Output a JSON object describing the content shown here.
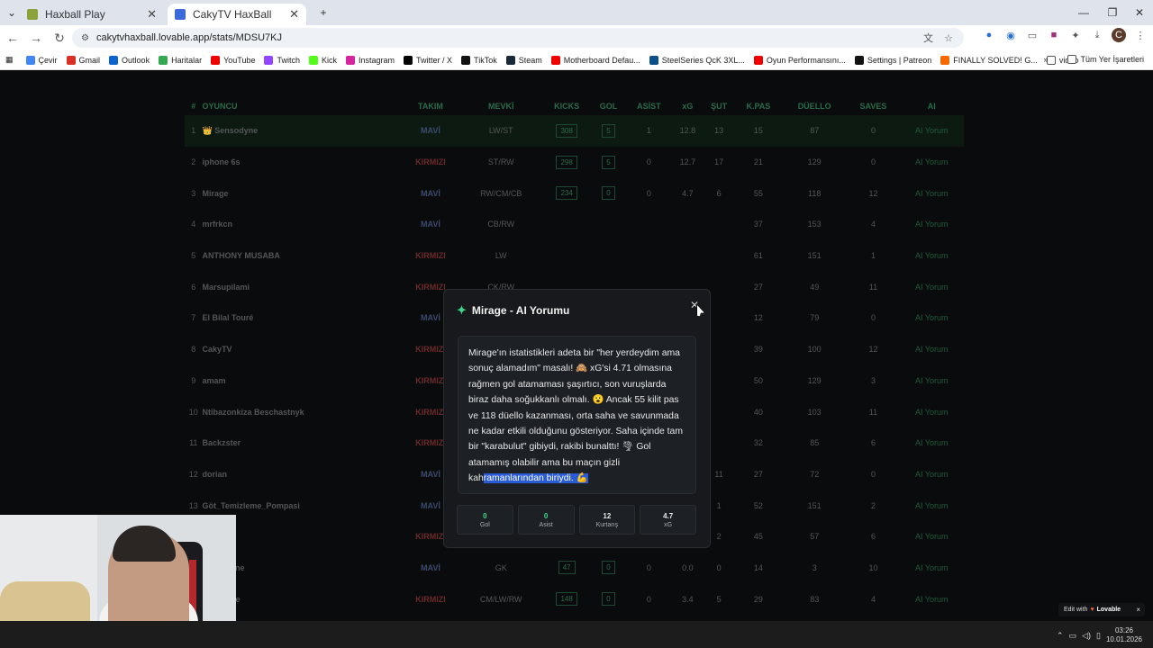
{
  "browser": {
    "tabs": [
      {
        "label": "Haxball Play",
        "favicon_color": "#8aa13c",
        "active": false
      },
      {
        "label": "CakyTV HaxBall",
        "favicon_color": "#3b6bd6",
        "active": true
      }
    ],
    "new_tab_icon": "plus-icon",
    "url": "cakytvhaxball.lovable.app/stats/MDSU7KJ",
    "bookmarks": [
      "Çevir",
      "Gmail",
      "Outlook",
      "Haritalar",
      "YouTube",
      "Twitch",
      "Kick",
      "Instagram",
      "Twitter / X",
      "TikTok",
      "Steam",
      "Motherboard Defau...",
      "SteelSeries QcK 3XL...",
      "Oyun Performansını...",
      "Settings | Patreon",
      "FINALLY SOLVED! G...",
      "video"
    ],
    "bookmarks_more": "»",
    "all_bookmarks": "Tüm Yer İşaretleri"
  },
  "table": {
    "headers": [
      "#",
      "OYUNCU",
      "TAKIM",
      "MEVKİ",
      "KICKS",
      "GOL",
      "ASİST",
      "xG",
      "ŞUT",
      "K.PAS",
      "DÜELLO",
      "SAVES",
      "AI"
    ],
    "rows": [
      [
        "1",
        "👑 Sensodyne",
        "MAVİ",
        "LW/ST",
        "308",
        "5",
        "1",
        "12.8",
        "13",
        "15",
        "87",
        "0",
        "AI Yorum"
      ],
      [
        "2",
        "iphone 6s",
        "KIRMIZI",
        "ST/RW",
        "298",
        "5",
        "0",
        "12.7",
        "17",
        "21",
        "129",
        "0",
        "AI Yorum"
      ],
      [
        "3",
        "Mirage",
        "MAVİ",
        "RW/CM/CB",
        "234",
        "0",
        "0",
        "4.7",
        "6",
        "55",
        "118",
        "12",
        "AI Yorum"
      ],
      [
        "4",
        "mrfrkcn",
        "MAVİ",
        "CB/RW",
        "",
        "",
        "",
        "",
        "",
        "37",
        "153",
        "4",
        "AI Yorum"
      ],
      [
        "5",
        "ANTHONY MUSABA",
        "KIRMIZI",
        "LW",
        "",
        "",
        "",
        "",
        "",
        "61",
        "151",
        "1",
        "AI Yorum"
      ],
      [
        "6",
        "Marsupilami",
        "KIRMIZI",
        "CK/RW",
        "",
        "",
        "",
        "",
        "",
        "27",
        "49",
        "11",
        "AI Yorum"
      ],
      [
        "7",
        "El Bilal Touré",
        "MAVİ",
        "",
        "",
        "",
        "",
        "",
        "",
        "12",
        "79",
        "0",
        "AI Yorum"
      ],
      [
        "8",
        "CakyTV",
        "KIRMIZI",
        "",
        "",
        "",
        "",
        "",
        "",
        "39",
        "100",
        "12",
        "AI Yorum"
      ],
      [
        "9",
        "amam",
        "KIRMIZI",
        "RW/ST",
        "",
        "",
        "",
        "",
        "",
        "50",
        "129",
        "3",
        "AI Yorum"
      ],
      [
        "10",
        "Ntibazonkiza Beschastnyk",
        "KIRMIZI",
        "",
        "",
        "",
        "",
        "",
        "",
        "40",
        "103",
        "11",
        "AI Yorum"
      ],
      [
        "11",
        "Backzster",
        "KIRMIZI",
        "CB/RW",
        "",
        "",
        "",
        "",
        "",
        "32",
        "85",
        "6",
        "AI Yorum"
      ],
      [
        "12",
        "dorian",
        "MAVİ",
        "LW/RW/ST",
        "159",
        "1",
        "1",
        "7.7",
        "11",
        "27",
        "72",
        "0",
        "AI Yorum"
      ],
      [
        "13",
        "Göt_Temizleme_Pompasi",
        "MAVİ",
        "ST/LW/CB",
        "287",
        "0",
        "1",
        "2.4",
        "1",
        "52",
        "151",
        "2",
        "AI Yorum"
      ],
      [
        "14",
        "arez",
        "KIRMIZI",
        "GK/CK",
        "156",
        "0",
        "0",
        "0.3",
        "2",
        "45",
        "57",
        "6",
        "AI Yorum"
      ],
      [
        "15",
        "warepyone",
        "MAVİ",
        "GK",
        "47",
        "0",
        "0",
        "0.0",
        "0",
        "14",
        "3",
        "10",
        "AI Yorum"
      ],
      [
        "16",
        "eslingerie",
        "KIRMIZI",
        "CM/LW/RW",
        "148",
        "0",
        "0",
        "3.4",
        "5",
        "29",
        "83",
        "4",
        "AI Yorum"
      ]
    ]
  },
  "modal": {
    "title": "Mirage - AI Yorumu",
    "text_before": "Mirage'ın istatistikleri adeta bir \"her yerdeydim ama sonuç alamadım\" masalı! 🙈 xG'si 4.71 olmasına rağmen gol atamaması şaşırtıcı, son vuruşlarda biraz daha soğukkanlı olmalı. 😮 Ancak 55 kilit pas ve 118 düello kazanması, orta saha ve savunmada ne kadar etkili olduğunu gösteriyor. Saha içinde tam bir \"karabulut\" gibiydi, rakibi bunalttı! 🌪 Gol atamamış olabilir ama bu maçın gizli kah",
    "text_selected": "ramanlarından biriydi. 💪",
    "stats": [
      {
        "value": "0",
        "label": "Gol",
        "color": "#3ed78a"
      },
      {
        "value": "0",
        "label": "Asist",
        "color": "#3ed78a"
      },
      {
        "value": "12",
        "label": "Kurtarış",
        "color": "#e6e6e6"
      },
      {
        "value": "4.7",
        "label": "xG",
        "color": "#e6e6e6"
      }
    ]
  },
  "lovable_badge": {
    "edit": "Edit with",
    "brand": "Lovable",
    "close": "×"
  },
  "taskbar": {
    "time": "03:26",
    "date": "10.01.2026"
  },
  "colors": {
    "accent": "#3ed78a",
    "modal_bg": "#17191c",
    "selection": "#2a5bd7"
  }
}
